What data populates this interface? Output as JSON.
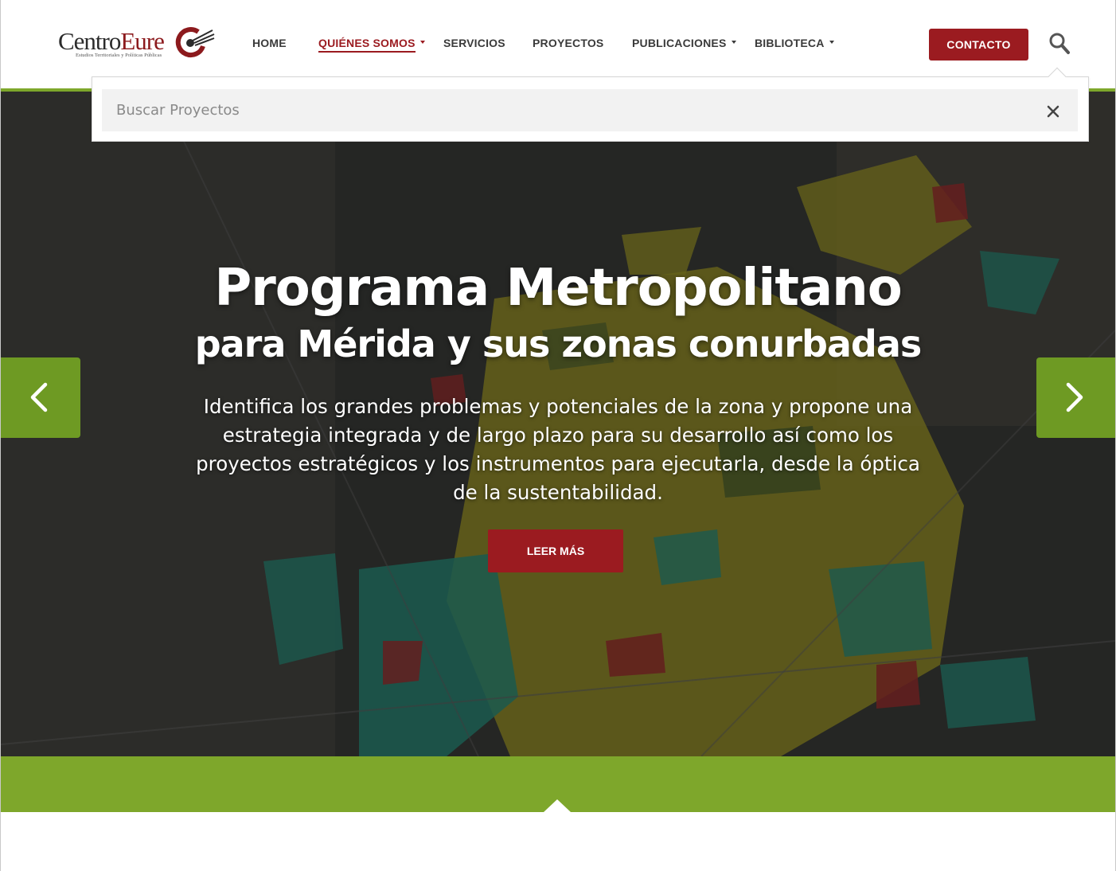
{
  "brand": {
    "name_part1": "Centro",
    "name_part2": "Eure",
    "tagline": "Estudios Territoriales y Políticas Públicas",
    "brand_color": "#9b1b20",
    "accent_color": "#7ea72b"
  },
  "nav": {
    "items": [
      {
        "label": "HOME",
        "has_dropdown": false,
        "active": false
      },
      {
        "label": "QUIÉNES SOMOS",
        "has_dropdown": true,
        "active": true
      },
      {
        "label": "SERVICIOS",
        "has_dropdown": false,
        "active": false
      },
      {
        "label": "PROYECTOS",
        "has_dropdown": false,
        "active": false
      },
      {
        "label": "PUBLICACIONES",
        "has_dropdown": true,
        "active": false
      },
      {
        "label": "BIBLIOTECA",
        "has_dropdown": true,
        "active": false
      }
    ],
    "contact_label": "CONTACTO",
    "search_icon": "magnifier-icon"
  },
  "search": {
    "placeholder": "Buscar Proyectos",
    "value": "",
    "close_icon": "close-icon"
  },
  "hero": {
    "title": "Programa Metropolitano",
    "subtitle": "para Mérida y sus zonas conurbadas",
    "description": "Identifica los grandes problemas y potenciales de la zona y propone una estrategia integrada y de largo plazo para su desarrollo así como los proyectos estratégicos y los instrumentos para ejecutarla, desde la óptica de la sustentabilidad.",
    "button_label": "LEER MÁS",
    "prev_icon": "chevron-left-icon",
    "next_icon": "chevron-right-icon"
  }
}
